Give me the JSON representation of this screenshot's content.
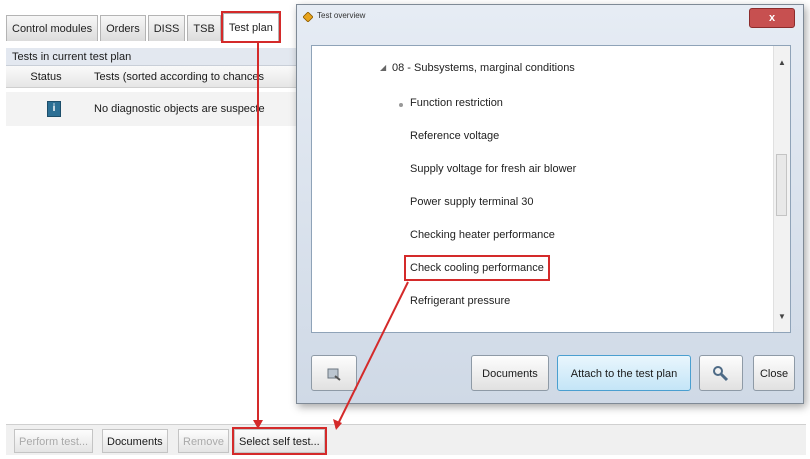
{
  "app": {
    "tabs": [
      {
        "label": "Control modules"
      },
      {
        "label": "Orders"
      },
      {
        "label": "DISS"
      },
      {
        "label": "TSB"
      },
      {
        "label": "Test plan"
      }
    ],
    "panel_title": "Tests in current test plan",
    "columns": {
      "status": "Status",
      "tests": "Tests (sorted according to chances"
    },
    "row_text": "No diagnostic objects are suspecte",
    "bottom_buttons": {
      "perform": "Perform test...",
      "documents": "Documents",
      "remove": "Remove",
      "select": "Select self test..."
    }
  },
  "dialog": {
    "title": "Test overview",
    "close": "x",
    "tree": [
      {
        "label": "08 - Subsystems, marginal conditions"
      },
      {
        "label": "Function restriction"
      },
      {
        "label": "Reference voltage"
      },
      {
        "label": "Supply voltage for fresh air blower"
      },
      {
        "label": "Power supply terminal 30"
      },
      {
        "label": "Checking heater performance"
      },
      {
        "label": "Check cooling performance"
      },
      {
        "label": "Refrigerant pressure"
      }
    ],
    "buttons": {
      "documents": "Documents",
      "attach": "Attach to the test plan",
      "close": "Close"
    }
  },
  "colors": {
    "highlight": "#d42a2a",
    "primary_button": "#c4e5f7",
    "info_icon": "#2c6f94"
  },
  "icons": [
    "info-icon",
    "app-icon",
    "close-icon",
    "collapse-icon",
    "magnifier-icon",
    "wrench-icon"
  ]
}
